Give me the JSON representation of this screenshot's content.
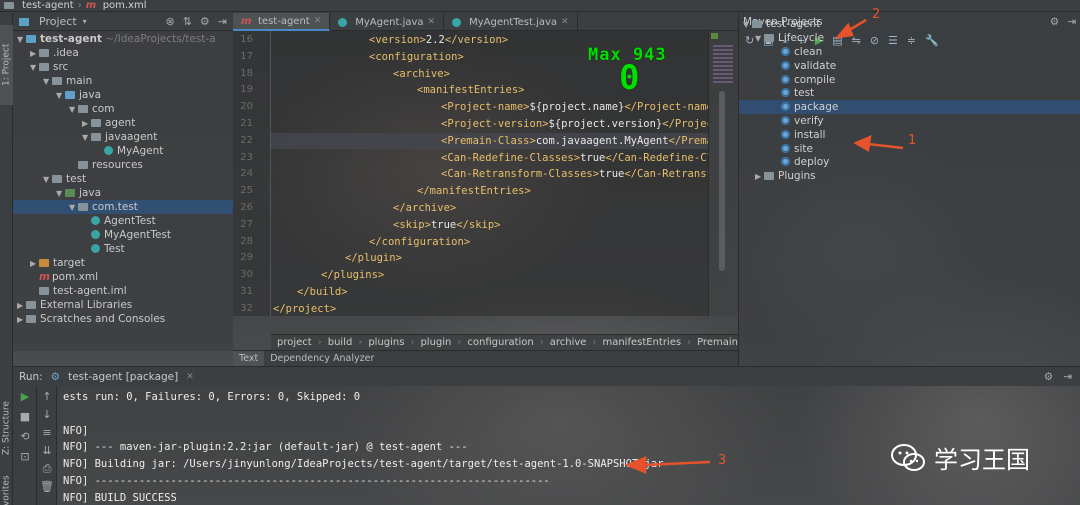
{
  "nav": {
    "root": "test-agent",
    "file": "pom.xml"
  },
  "left_stripe": {
    "project_tab": "1: Project",
    "structure_tab": "Z: Structure",
    "favorites_tab": "Favorites"
  },
  "project": {
    "header_label": "Project",
    "tree": [
      {
        "label": "test-agent",
        "suffix": "~/IdeaProjects/test-a",
        "icon": "folder-icon"
      },
      {
        "label": ".idea",
        "icon": "folder-icon"
      },
      {
        "label": "src",
        "icon": "folder-icon"
      },
      {
        "label": "main",
        "icon": "folder-icon"
      },
      {
        "label": "java",
        "icon": "source-folder-icon"
      },
      {
        "label": "com",
        "icon": "package-icon"
      },
      {
        "label": "agent",
        "icon": "package-icon"
      },
      {
        "label": "javaagent",
        "icon": "package-icon"
      },
      {
        "label": "MyAgent",
        "icon": "class-icon"
      },
      {
        "label": "resources",
        "icon": "resources-folder-icon"
      },
      {
        "label": "test",
        "icon": "folder-icon"
      },
      {
        "label": "java",
        "icon": "test-folder-icon"
      },
      {
        "label": "com.test",
        "icon": "package-icon"
      },
      {
        "label": "AgentTest",
        "icon": "class-icon"
      },
      {
        "label": "MyAgentTest",
        "icon": "class-icon"
      },
      {
        "label": "Test",
        "icon": "class-icon"
      },
      {
        "label": "target",
        "icon": "excluded-folder-icon"
      },
      {
        "label": "pom.xml",
        "icon": "maven-file-icon"
      },
      {
        "label": "test-agent.iml",
        "icon": "module-file-icon"
      },
      {
        "label": "External Libraries",
        "icon": "library-icon"
      },
      {
        "label": "Scratches and Consoles",
        "icon": "scratch-icon"
      }
    ]
  },
  "editor": {
    "tabs": [
      {
        "label": "test-agent"
      },
      {
        "label": "MyAgent.java"
      },
      {
        "label": "MyAgentTest.java"
      }
    ],
    "line_numbers": [
      "16",
      "17",
      "18",
      "19",
      "20",
      "21",
      "22",
      "23",
      "24",
      "25",
      "26",
      "27",
      "28",
      "29",
      "30",
      "31",
      "32"
    ],
    "lines": [
      {
        "t1": "<version>",
        "v": "2.2",
        "t2": "</version>"
      },
      {
        "t1": "<configuration>",
        "v": "",
        "t2": ""
      },
      {
        "t1": "<archive>",
        "v": "",
        "t2": ""
      },
      {
        "t1": "<manifestEntries>",
        "v": "",
        "t2": ""
      },
      {
        "t1": "<Project-name>",
        "v": "${project.name}",
        "t2": "</Project-name>"
      },
      {
        "t1": "<Project-version>",
        "v": "${project.version}",
        "t2": "</Project-ve"
      },
      {
        "t1": "<Premain-Class>",
        "v": "com.javaagent.MyAgent",
        "t2": "</Premain-C"
      },
      {
        "t1": "<Can-Redefine-Classes>",
        "v": "true",
        "t2": "</Can-Redefine-Classe"
      },
      {
        "t1": "<Can-Retransform-Classes>",
        "v": "true",
        "t2": "</Can-Retransform-"
      },
      {
        "t1": "</manifestEntries>",
        "v": "",
        "t2": ""
      },
      {
        "t1": "</archive>",
        "v": "",
        "t2": ""
      },
      {
        "t1": "<skip>",
        "v": "true",
        "t2": "</skip>"
      },
      {
        "t1": "</configuration>",
        "v": "",
        "t2": ""
      },
      {
        "t1": "</plugin>",
        "v": "",
        "t2": ""
      },
      {
        "t1": "</plugins>",
        "v": "",
        "t2": ""
      },
      {
        "t1": "</build>",
        "v": "",
        "t2": ""
      },
      {
        "t1": "</project>",
        "v": "",
        "t2": ""
      }
    ],
    "breadcrumb": [
      "project",
      "build",
      "plugins",
      "plugin",
      "configuration",
      "archive",
      "manifestEntries",
      "Premain-Cl"
    ],
    "bottom_tabs": {
      "text": "Text",
      "dependency": "Dependency Analyzer"
    },
    "overlay": {
      "max_label": "Max 943",
      "value": "0"
    }
  },
  "maven": {
    "title": "Maven Projects",
    "root": "test-agent",
    "lifecycle": "Lifecycle",
    "goals": [
      "clean",
      "validate",
      "compile",
      "test",
      "package",
      "verify",
      "install",
      "site",
      "deploy"
    ],
    "plugins": "Plugins",
    "selected": "package"
  },
  "run": {
    "label": "Run:",
    "config": "test-agent [package]",
    "console": [
      "ests run: 0, Failures: 0, Errors: 0, Skipped: 0",
      "",
      "NFO]",
      "NFO] --- maven-jar-plugin:2.2:jar (default-jar) @ test-agent ---",
      "NFO] Building jar: /Users/jinyunlong/IdeaProjects/test-agent/target/test-agent-1.0-SNAPSHOT.jar",
      "NFO] ------------------------------------------------------------------------",
      "NFO] BUILD SUCCESS"
    ]
  },
  "annotations": {
    "n1": "1",
    "n2": "2",
    "n3": "3",
    "color": "#e5532c"
  },
  "watermark": {
    "text": "学习王国"
  }
}
